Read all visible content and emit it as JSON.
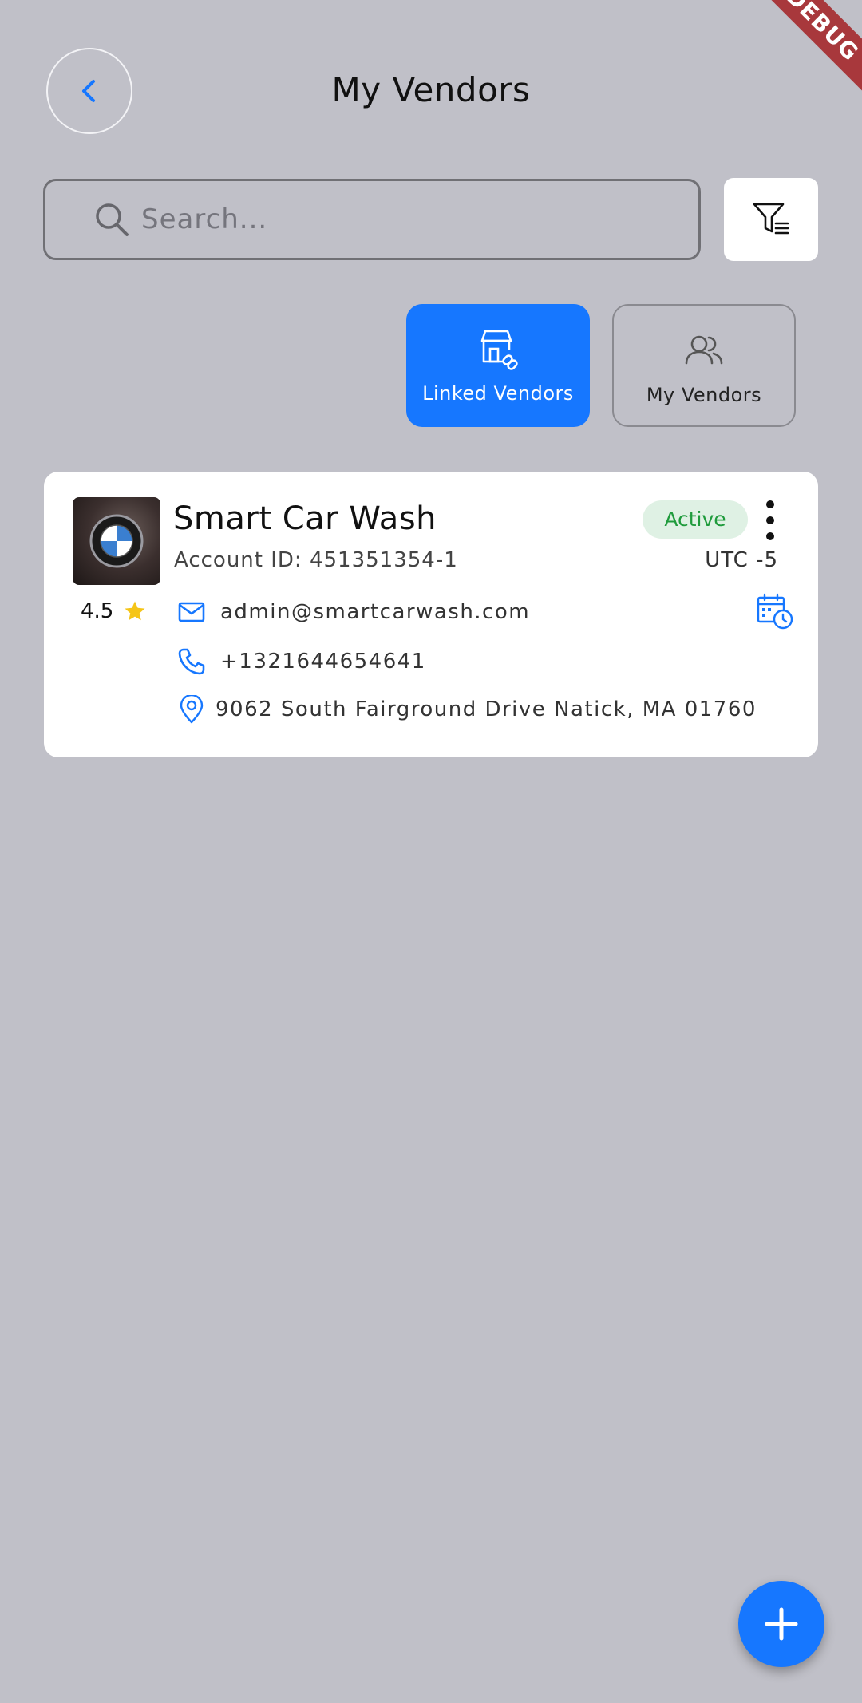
{
  "banner": {
    "text": "DEBUG"
  },
  "header": {
    "title": "My Vendors",
    "back_icon": "chevron-left-icon"
  },
  "search": {
    "placeholder": "Search...",
    "value": "",
    "filter_icon": "filter-icon"
  },
  "tabs": [
    {
      "label": "Linked Vendors",
      "icon": "store-link-icon",
      "selected": true
    },
    {
      "label": "My Vendors",
      "icon": "users-icon",
      "selected": false
    }
  ],
  "vendors": [
    {
      "name": "Smart Car Wash",
      "account_id": "Account ID: 451351354-1",
      "status": "Active",
      "timezone": "UTC -5",
      "rating": "4.5",
      "email": "admin@smartcarwash.com",
      "phone": "+1321644654641",
      "address": "9062 South Fairground Drive Natick, MA 01760"
    }
  ],
  "colors": {
    "accent": "#1677ff",
    "background": "#c0c0c8",
    "status_active_bg": "#dff1e4",
    "status_active_text": "#1f9b3c",
    "star": "#f5c518"
  }
}
